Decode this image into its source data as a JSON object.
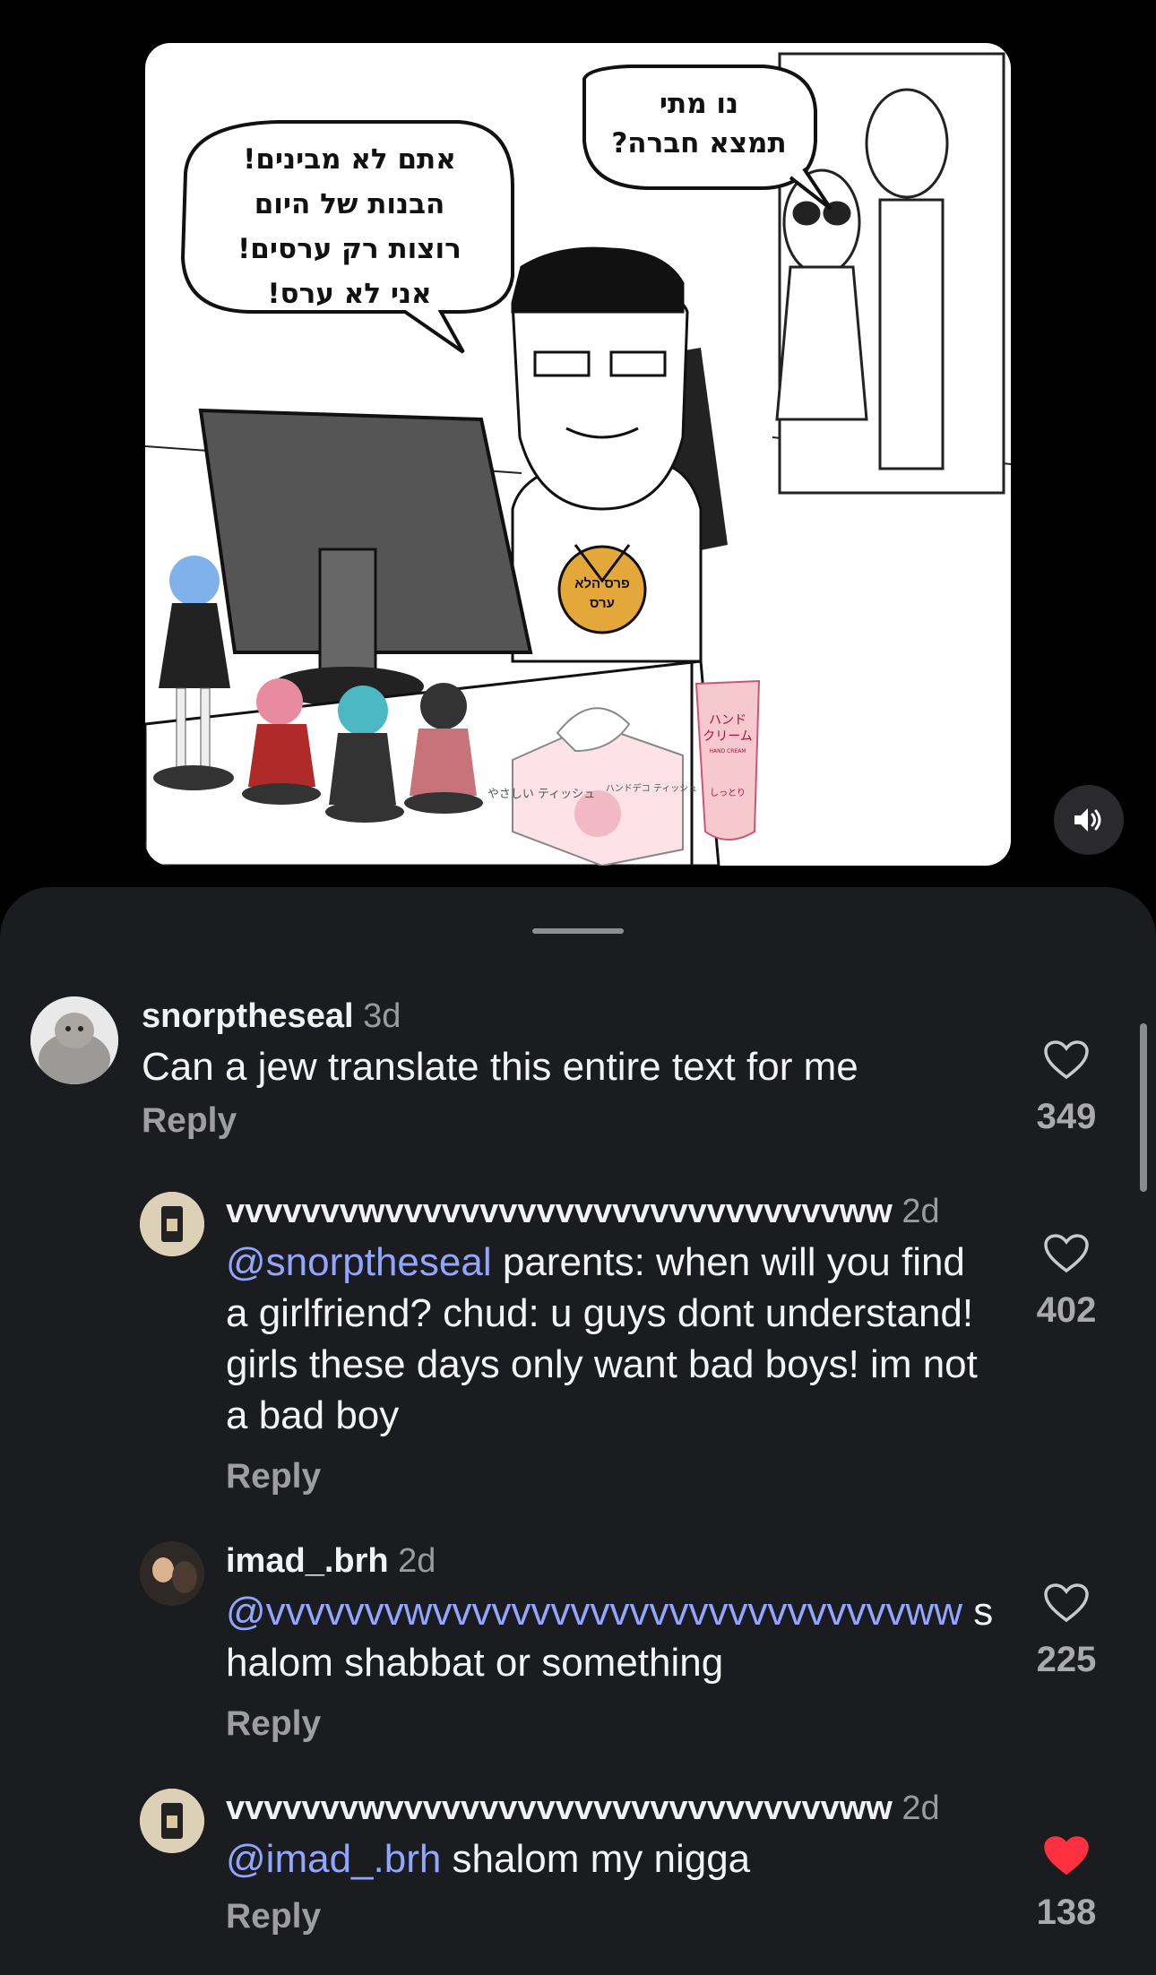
{
  "comic": {
    "bubble_left": [
      "אתם לא מבינים!",
      "הבנות של היום",
      "רוצות רק ערסים!",
      "אני לא ערס!"
    ],
    "bubble_right": [
      "נו מתי",
      "תמצא חברה?"
    ],
    "medal": [
      "פרס הלא",
      "ערס"
    ],
    "tissue_box": "やさしい\nティッシュ",
    "tissue_side": "ハンドデコ\nティッシュ",
    "hand_cream": [
      "ハンド",
      "クリーム",
      "HAND CREAM"
    ],
    "hand_cream_bottom": "しっとり"
  },
  "sound_icon": "speaker-icon",
  "comments": [
    {
      "username": "snorptheseal",
      "time": "3d",
      "text_parts": [
        {
          "mention": "",
          "text": "Can a jew translate this entire text for me"
        }
      ],
      "reply_label": "Reply",
      "likes": "349",
      "liked": false
    },
    {
      "username": "vvvvvvvwvvvvvvvvvvvvvvvvvvvvvvvvww",
      "time": "2d",
      "text_parts": [
        {
          "mention": "@snorptheseal",
          "text": " parents: when will you find a girlfriend? chud: u guys dont understand! girls these days only want bad boys! im not a bad boy"
        }
      ],
      "reply_label": "Reply",
      "likes": "402",
      "liked": false
    },
    {
      "username": "imad_.brh",
      "time": "2d",
      "text_parts": [
        {
          "mention": "@vvvvvvvwvvvvvvvvvvvvvvvvvvvvvvvvww",
          "text": " shalom shabbat or something"
        }
      ],
      "reply_label": "Reply",
      "likes": "225",
      "liked": false
    },
    {
      "username": "vvvvvvvwvvvvvvvvvvvvvvvvvvvvvvvvww",
      "time": "2d",
      "text_parts": [
        {
          "mention": "@imad_.brh",
          "text": " shalom my nigga"
        }
      ],
      "reply_label": "Reply",
      "likes": "138",
      "liked": true
    }
  ],
  "colors": {
    "sheet_bg": "#1b1c1f",
    "mention": "#93a6ff",
    "liked_heart": "#ff3040",
    "muted": "#9d9da3"
  }
}
